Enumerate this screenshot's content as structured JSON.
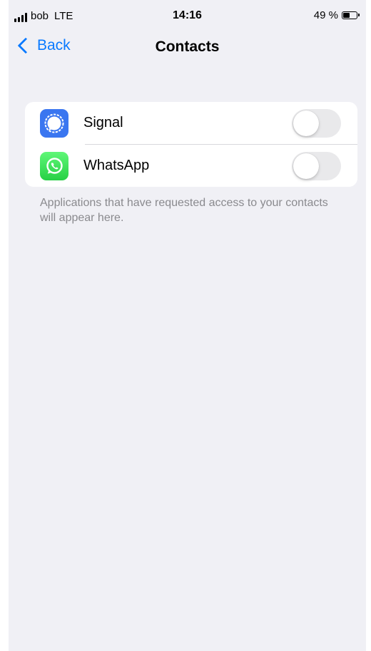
{
  "status_bar": {
    "carrier": "bob",
    "network": "LTE",
    "time": "14:16",
    "battery_text": "49 %",
    "battery_level": 0.49
  },
  "nav": {
    "back_label": "Back",
    "title": "Contacts"
  },
  "apps": [
    {
      "name": "Signal",
      "icon": "signal-app-icon",
      "toggle_on": false
    },
    {
      "name": "WhatsApp",
      "icon": "whatsapp-app-icon",
      "toggle_on": false
    }
  ],
  "footer_note": "Applications that have requested access to your contacts will appear here.",
  "colors": {
    "accent": "#0a7aff",
    "background": "#f0f0f5",
    "signal": "#3a76f0",
    "whatsapp": "#2fd553",
    "toggle_off": "#e9e9eb",
    "secondary_text": "#8a8a8e"
  }
}
